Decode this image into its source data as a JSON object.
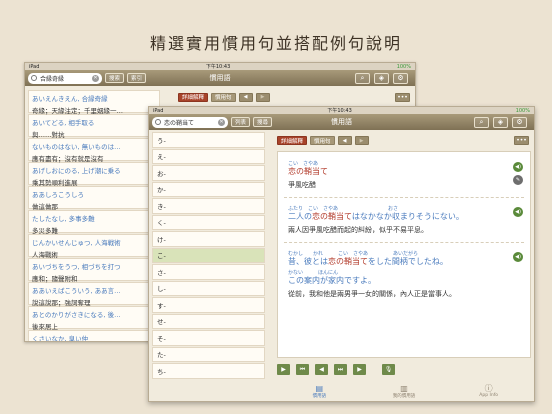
{
  "headline": "精選實用慣用句並搭配例句說明",
  "back_device": {
    "status": {
      "carrier": "iPad",
      "time": "下午10:43",
      "battery": "100%"
    },
    "title": "慣用語",
    "search_value": "合縁奇縁",
    "pills": [
      "搜索",
      "索引"
    ],
    "sub_tabs": [
      "詳細解釋",
      "慣用句"
    ],
    "more": "•••",
    "items": [
      {
        "jp": "あいえんきえん, 合縁奇縁",
        "zh": "奇緣；天緣注定；千里姻緣一…"
      },
      {
        "jp": "あいてどる, 相手取る",
        "zh": "與……對抗"
      },
      {
        "jp": "ないものはない, 無いものは…",
        "zh": "應有盡有；沒有就是沒有"
      },
      {
        "jp": "あげしおにのる, 上げ潮に乗る",
        "zh": "乘其勢順利進展"
      },
      {
        "jp": "ああしろこうしろ",
        "zh": "做這做那"
      },
      {
        "jp": "たしたなし, 多事多難",
        "zh": "多災多難"
      },
      {
        "jp": "じんかいせんじゅつ, 人海戦術",
        "zh": "人海戰術"
      },
      {
        "jp": "あいづちをうつ, 相づちを打つ",
        "zh": "應和；隨聲附和"
      },
      {
        "jp": "ああいえばこういう, ああ言…",
        "zh": "說這說那；強詞奪理"
      },
      {
        "jp": "あとのかりがさきになる, 後…",
        "zh": "後來居上"
      },
      {
        "jp": "くさいなか, 臭い仲",
        "zh": ""
      }
    ]
  },
  "front_device": {
    "status": {
      "carrier": "iPad",
      "time": "下午10:43",
      "battery": "100%"
    },
    "title": "慣用語",
    "search_value": "恋の鞘当て",
    "pills": [
      "列表",
      "搜尋"
    ],
    "sub_tabs": [
      "詳細解釋",
      "慣用句"
    ],
    "more": "•••",
    "kana": [
      "う-",
      "え-",
      "お-",
      "か-",
      "き-",
      "く-",
      "け-",
      "こ-",
      "さ-",
      "し-",
      "す-",
      "せ-",
      "そ-",
      "た-",
      "ち-"
    ],
    "selected_kana_index": 7,
    "entries": [
      {
        "ruby": "こい　さやあ",
        "jp_pre": "",
        "jp_hl": "恋の鞘当て",
        "jp_post": "",
        "zh": "爭風吃醋"
      },
      {
        "ruby": "ふたり　こい　さやあ　　　　　　　　　　おさ",
        "jp_pre": "二人の",
        "jp_hl": "恋の鞘当て",
        "jp_post": "はなかなか収まりそうにない。",
        "zh": "兩人因爭風吃醋而起的糾紛，似乎不易平息。"
      },
      {
        "ruby": "むかし　　かれ　　　こい　さやあ　　　　　あいだがら",
        "ruby2": "かない　　　ほんにん",
        "jp_pre": "昔、彼とは",
        "jp_hl": "恋の鞘当て",
        "jp_post": "をした間柄でしたね。",
        "jp_line2": "この案内が家内ですよ。",
        "zh": "從前，我和他是兩男爭一女的關係，內人正是當事人。"
      }
    ],
    "tabbar": [
      {
        "label": "慣用語",
        "icon": "book-icon"
      },
      {
        "label": "我的慣用語",
        "icon": "bookmark-icon"
      },
      {
        "label": "App Info",
        "icon": "info-icon"
      }
    ]
  }
}
